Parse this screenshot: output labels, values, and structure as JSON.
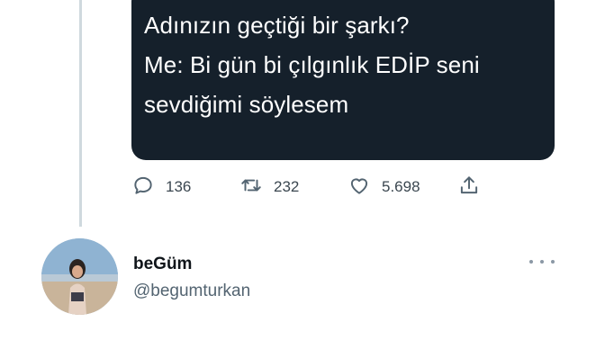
{
  "quoted_tweet": {
    "lines": [
      "Adınızın geçtiği bir şarkı?",
      "Me: Bi gün bi çılgınlık EDİP seni",
      "sevdiğimi söylesem"
    ]
  },
  "actions": {
    "reply": {
      "icon": "reply-icon",
      "count": "136"
    },
    "retweet": {
      "icon": "retweet-icon",
      "count": "232"
    },
    "like": {
      "icon": "heart-icon",
      "count": "5.698"
    },
    "share": {
      "icon": "share-icon"
    }
  },
  "next_tweet": {
    "display_name": "beGüm",
    "handle": "@begumturkan"
  },
  "colors": {
    "card_background": "#15202b",
    "thread_line": "#cfd9de",
    "muted_text": "#536471"
  }
}
